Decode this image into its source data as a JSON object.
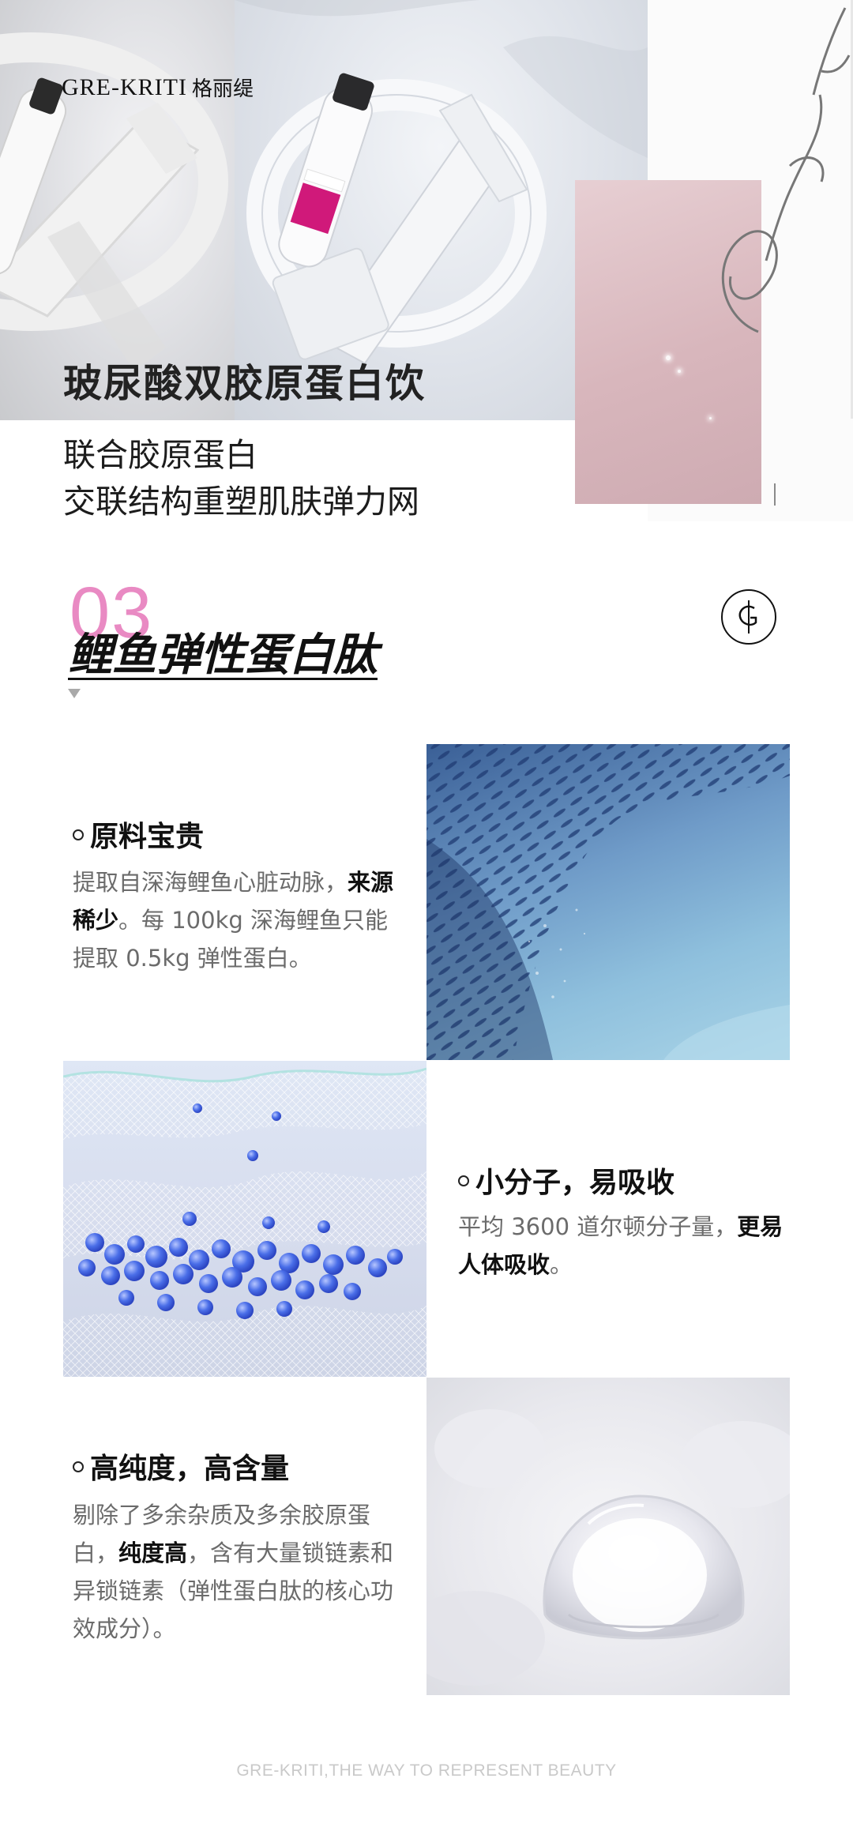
{
  "brand": {
    "name_en": "GRE-KRITI",
    "name_cn": "格丽缇",
    "script_signature": "Gre-kriti"
  },
  "hero": {
    "title": "玻尿酸双胶原蛋白饮",
    "subtitle_line1": "联合胶原蛋白",
    "subtitle_line2": "交联结构重塑肌肤弹力网"
  },
  "section": {
    "number": "03",
    "title": "鲤鱼弹性蛋白肽"
  },
  "features": [
    {
      "title": "原料宝贵",
      "body_pre": "提取自深海鲤鱼心脏动脉，",
      "body_bold": "来源稀少",
      "body_post": "。每 100kg 深海鲤鱼只能提取 0.5kg 弹性蛋白。"
    },
    {
      "title": "小分子，易吸收",
      "body_pre": "平均 3600 道尔顿分子量，",
      "body_bold": "更易人体吸收",
      "body_post": "。"
    },
    {
      "title": "高纯度，高含量",
      "body_pre": "剔除了多余杂质及多余胶原蛋白，",
      "body_bold": "纯度高",
      "body_post": "，含有大量锁链素和异锁链素（弹性蛋白肽的核心功效成分）。"
    }
  ],
  "footer": {
    "tagline": "GRE-KRITI,THE WAY TO REPRESENT BEAUTY"
  },
  "colors": {
    "accent_pink": "#e98ac3",
    "product_magenta": "#d0197a"
  }
}
